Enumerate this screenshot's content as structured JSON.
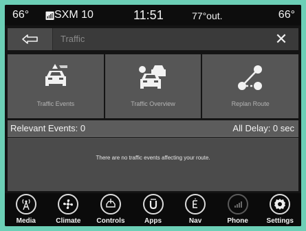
{
  "status_bar": {
    "left_temp": "66°",
    "radio": "SXM 10",
    "time": "11:51",
    "outside_temp": "77°out.",
    "right_temp": "66°"
  },
  "title_bar": {
    "title": "Traffic"
  },
  "tiles": [
    {
      "label": "Traffic Events"
    },
    {
      "label": "Traffic Overview"
    },
    {
      "label": "Replan Route"
    }
  ],
  "events": {
    "relevant": "Relevant Events: 0",
    "all_delay": "All Delay: 0 sec",
    "message": "There are no traffic events affecting your route."
  },
  "nav": [
    {
      "label": "Media",
      "icon": "media-icon"
    },
    {
      "label": "Climate",
      "icon": "climate-icon"
    },
    {
      "label": "Controls",
      "icon": "controls-icon"
    },
    {
      "label": "Apps",
      "icon": "apps-icon"
    },
    {
      "label": "Nav",
      "icon": "nav-icon"
    },
    {
      "label": "Phone",
      "icon": "phone-icon"
    },
    {
      "label": "Settings",
      "icon": "settings-icon"
    }
  ]
}
